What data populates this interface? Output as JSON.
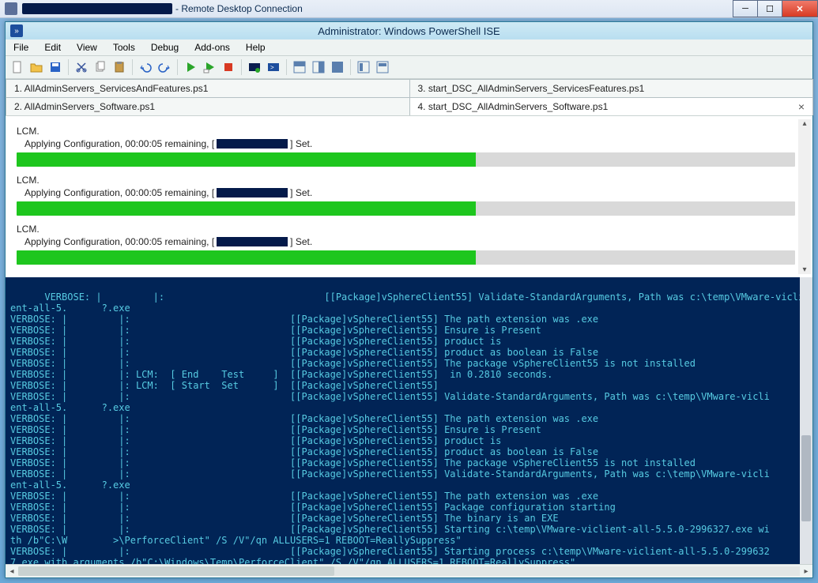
{
  "rdc": {
    "title_suffix": " - Remote Desktop Connection"
  },
  "winctl": {
    "min": "─",
    "max": "☐",
    "close": "✕"
  },
  "ise": {
    "title": "Administrator: Windows PowerShell ISE",
    "menu": {
      "file": "File",
      "edit": "Edit",
      "view": "View",
      "tools": "Tools",
      "debug": "Debug",
      "addons": "Add-ons",
      "help": "Help"
    }
  },
  "tabs": {
    "t1": "1. AllAdminServers_ServicesAndFeatures.ps1",
    "t3": "3. start_DSC_AllAdminServers_ServicesFeatures.ps1",
    "t2": "2. AllAdminServers_Software.ps1",
    "t4": "4. start_DSC_AllAdminServers_Software.ps1"
  },
  "progress": {
    "lcm": "LCM.",
    "apply_prefix": "Applying Configuration, 00:00:05 remaining, [",
    "apply_suffix": "] Set.",
    "percent": 59
  },
  "console_text": "VERBOSE: |         |:                            [[Package]vSphereClient55] Validate-StandardArguments, Path was c:\\temp\\VMware-vicli\nent-all-5.      ?.exe\nVERBOSE: |         |:                            [[Package]vSphereClient55] The path extension was .exe\nVERBOSE: |         |:                            [[Package]vSphereClient55] Ensure is Present\nVERBOSE: |         |:                            [[Package]vSphereClient55] product is\nVERBOSE: |         |:                            [[Package]vSphereClient55] product as boolean is False\nVERBOSE: |         |:                            [[Package]vSphereClient55] The package vSphereClient55 is not installed\nVERBOSE: |         |: LCM:  [ End    Test     ]  [[Package]vSphereClient55]  in 0.2810 seconds.\nVERBOSE: |         |: LCM:  [ Start  Set      ]  [[Package]vSphereClient55]\nVERBOSE: |         |:                            [[Package]vSphereClient55] Validate-StandardArguments, Path was c:\\temp\\VMware-vicli\nent-all-5.      ?.exe\nVERBOSE: |         |:                            [[Package]vSphereClient55] The path extension was .exe\nVERBOSE: |         |:                            [[Package]vSphereClient55] Ensure is Present\nVERBOSE: |         |:                            [[Package]vSphereClient55] product is\nVERBOSE: |         |:                            [[Package]vSphereClient55] product as boolean is False\nVERBOSE: |         |:                            [[Package]vSphereClient55] The package vSphereClient55 is not installed\nVERBOSE: |         |:                            [[Package]vSphereClient55] Validate-StandardArguments, Path was c:\\temp\\VMware-vicli\nent-all-5.      ?.exe\nVERBOSE: |         |:                            [[Package]vSphereClient55] The path extension was .exe\nVERBOSE: |         |:                            [[Package]vSphereClient55] Package configuration starting\nVERBOSE: |         |:                            [[Package]vSphereClient55] The binary is an EXE\nVERBOSE: |         |:                            [[Package]vSphereClient55] Starting c:\\temp\\VMware-viclient-all-5.5.0-2996327.exe wi\nth /b\"C:\\W        >\\PerforceClient\" /S /V\"/qn ALLUSERS=1 REBOOT=ReallySuppress\"\nVERBOSE: |         |:                            [[Package]vSphereClient55] Starting process c:\\temp\\VMware-viclient-all-5.5.0-299632\n7.exe with arguments /b\"C:\\Windows\\Temp\\PerforceClient\" /S /V\"/qn ALLUSERS=1 REBOOT=ReallySuppress\""
}
